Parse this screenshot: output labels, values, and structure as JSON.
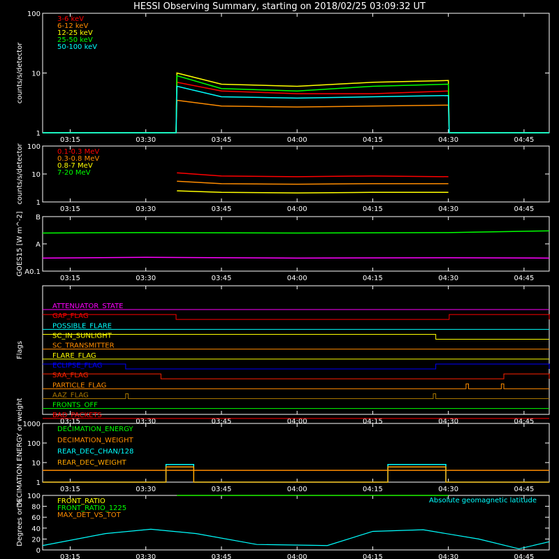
{
  "title": "HESSI Observing Summary, starting on 2018/02/25 03:09:32 UT",
  "x_range": [
    "03:09:32",
    "04:50:00"
  ],
  "x_ticks": [
    "03:15",
    "03:30",
    "03:45",
    "04:00",
    "04:15",
    "04:30",
    "04:45"
  ],
  "colors": {
    "red": "#ff0000",
    "orange": "#ff8c00",
    "yellow": "#ffff00",
    "green": "#00ff00",
    "cyan": "#00ffff",
    "magenta": "#ff00ff",
    "blue": "#0000ff",
    "white": "#ffffff"
  },
  "chart_data": [
    {
      "id": "lc",
      "type": "line",
      "ylabel": "counts/s/detector",
      "yscale": "log",
      "ylim": [
        1,
        100
      ],
      "y_ticks": [
        "1",
        "10",
        "100"
      ],
      "legend_position": "top-left",
      "series": [
        {
          "name": "3-6 keV",
          "color": "#ff0000",
          "x": [
            "03:09:32",
            "03:36:00",
            "03:36:10",
            "03:45:00",
            "04:00:00",
            "04:15:00",
            "04:30:00",
            "04:30:10",
            "04:50:00"
          ],
          "y": [
            1,
            1,
            7,
            5,
            4.5,
            4.5,
            5,
            1,
            1
          ]
        },
        {
          "name": "6-12 keV",
          "color": "#ff8c00",
          "x": [
            "03:09:32",
            "03:36:00",
            "03:36:10",
            "03:45:00",
            "04:00:00",
            "04:15:00",
            "04:30:00",
            "04:30:10",
            "04:50:00"
          ],
          "y": [
            1,
            1,
            3.5,
            2.8,
            2.7,
            2.8,
            2.9,
            1,
            1
          ]
        },
        {
          "name": "12-25 keV",
          "color": "#ffff00",
          "x": [
            "03:09:32",
            "03:36:00",
            "03:36:10",
            "03:45:00",
            "04:00:00",
            "04:15:00",
            "04:30:00",
            "04:30:10",
            "04:50:00"
          ],
          "y": [
            1,
            1,
            10,
            6.5,
            6,
            7,
            7.5,
            1,
            1
          ]
        },
        {
          "name": "25-50 keV",
          "color": "#00ff00",
          "x": [
            "03:09:32",
            "03:36:00",
            "03:36:10",
            "03:45:00",
            "04:00:00",
            "04:15:00",
            "04:30:00",
            "04:30:10",
            "04:50:00"
          ],
          "y": [
            1,
            1,
            9,
            5.5,
            5,
            6,
            6.5,
            1,
            1
          ]
        },
        {
          "name": "50-100 keV",
          "color": "#00ffff",
          "x": [
            "03:09:32",
            "03:36:00",
            "03:36:10",
            "03:45:00",
            "04:00:00",
            "04:15:00",
            "04:30:00",
            "04:30:10",
            "04:50:00"
          ],
          "y": [
            1,
            1,
            6,
            4,
            3.8,
            4,
            4.2,
            1,
            1
          ]
        }
      ]
    },
    {
      "id": "gamma",
      "type": "line",
      "ylabel": "counts/s/detector",
      "yscale": "log",
      "ylim": [
        1,
        100
      ],
      "y_ticks": [
        "1",
        "10",
        "100"
      ],
      "legend_position": "top-left",
      "series": [
        {
          "name": "0.1-0.3 MeV",
          "color": "#ff0000",
          "x": [
            "03:36:10",
            "03:45:00",
            "04:00:00",
            "04:15:00",
            "04:30:00"
          ],
          "y": [
            11,
            8.5,
            8,
            8.5,
            8
          ]
        },
        {
          "name": "0.3-0.8 MeV",
          "color": "#ff8c00",
          "x": [
            "03:36:10",
            "03:45:00",
            "04:00:00",
            "04:15:00",
            "04:30:00"
          ],
          "y": [
            5.5,
            4.5,
            4.3,
            4.5,
            4.5
          ]
        },
        {
          "name": "0.8-7 MeV",
          "color": "#ffff00",
          "x": [
            "03:36:10",
            "03:45:00",
            "04:00:00",
            "04:15:00",
            "04:30:00"
          ],
          "y": [
            2.5,
            2.2,
            2.1,
            2.2,
            2.2
          ]
        },
        {
          "name": "7-20 MeV",
          "color": "#00ff00",
          "x": [],
          "y": []
        }
      ]
    },
    {
      "id": "goes",
      "type": "line",
      "ylabel": "GOES15 [W m^-2]",
      "yscale": "log",
      "ylim": [
        0.1,
        10
      ],
      "y_ticks": [
        "A0.1",
        "A",
        "B"
      ],
      "series": [
        {
          "name": "long",
          "color": "#00ff00",
          "x": [
            "03:09:32",
            "03:30:00",
            "04:00:00",
            "04:30:00",
            "04:50:00"
          ],
          "y": [
            2.5,
            2.6,
            2.5,
            2.6,
            3.0
          ]
        },
        {
          "name": "short",
          "color": "#ff00ff",
          "x": [
            "03:09:32",
            "03:30:00",
            "04:00:00",
            "04:30:00",
            "04:50:00"
          ],
          "y": [
            0.3,
            0.32,
            0.3,
            0.31,
            0.3
          ]
        }
      ]
    },
    {
      "id": "flags",
      "type": "line",
      "ylabel": "Flags",
      "flags": [
        {
          "name": "ATTENUATOR_STATE",
          "color": "#ff00ff",
          "segments": []
        },
        {
          "name": "GAP_FLAG",
          "color": "#ff0000",
          "segments": [
            [
              "03:09:32",
              "03:36:00"
            ],
            [
              "04:30:10",
              "04:50:00"
            ]
          ]
        },
        {
          "name": "POSSIBLE_FLARE",
          "color": "#00ffff",
          "segments": []
        },
        {
          "name": "SC_IN_SUNLIGHT",
          "color": "#ffff00",
          "segments": [
            [
              "03:09:32",
              "04:27:30"
            ]
          ]
        },
        {
          "name": "SC_TRANSMITTER",
          "color": "#ff8c00",
          "segments": []
        },
        {
          "name": "FLARE_FLAG",
          "color": "#ffff00",
          "segments": []
        },
        {
          "name": "ECLIPSE_FLAG",
          "color": "#0000ff",
          "segments": [
            [
              "03:09:32",
              "03:26:00"
            ],
            [
              "04:27:30",
              "04:50:00"
            ]
          ]
        },
        {
          "name": "SAA_FLAG",
          "color": "#ff2200",
          "segments": [
            [
              "03:09:32",
              "03:33:00"
            ],
            [
              "04:41:00",
              "04:50:00"
            ]
          ]
        },
        {
          "name": "PARTICLE_FLAG",
          "color": "#ff8c00",
          "segments": [
            [
              "04:33:30",
              "04:34:00"
            ],
            [
              "04:40:30",
              "04:41:00"
            ]
          ]
        },
        {
          "name": "AAZ_FLAG",
          "color": "#aa7700",
          "segments": [
            [
              "03:26:00",
              "03:26:30"
            ],
            [
              "04:27:00",
              "04:27:30"
            ]
          ]
        },
        {
          "name": "FRONTS_OFF",
          "color": "#00ff00",
          "segments": []
        },
        {
          "name": "BAD_PACKETS",
          "color": "#ff0000",
          "segments": []
        }
      ]
    },
    {
      "id": "decim",
      "type": "line",
      "ylabel": "DECIMATION ENERGY or weight",
      "yscale": "log",
      "ylim": [
        1,
        1000
      ],
      "y_ticks": [
        "1",
        "10",
        "100",
        "1000"
      ],
      "legend_position": "top-left",
      "series": [
        {
          "name": "DECIMATION_ENERGY",
          "color": "#00ff00",
          "x": [],
          "y": []
        },
        {
          "name": "DECIMATION_WEIGHT",
          "color": "#ff8c00",
          "x": [
            "03:09:32",
            "04:50:00"
          ],
          "y": [
            4,
            4
          ]
        },
        {
          "name": "REAR_DEC_CHAN/128",
          "color": "#00ffff",
          "x": [
            "03:09:32",
            "03:34:00",
            "03:34:00",
            "03:39:30",
            "03:39:30",
            "04:18:00",
            "04:18:00",
            "04:29:30",
            "04:29:30",
            "04:50:00"
          ],
          "y": [
            1,
            1,
            8,
            8,
            1,
            1,
            8,
            8,
            1,
            1
          ]
        },
        {
          "name": "REAR_DEC_WEIGHT",
          "color": "#ffa500",
          "x": [
            "03:09:32",
            "03:34:00",
            "03:34:00",
            "03:39:30",
            "03:39:30",
            "04:18:00",
            "04:18:00",
            "04:29:30",
            "04:29:30",
            "04:50:00"
          ],
          "y": [
            1,
            1,
            6,
            6,
            1,
            1,
            6,
            6,
            1,
            1
          ]
        }
      ]
    },
    {
      "id": "ratio",
      "type": "line",
      "ylabel": "Degrees or %",
      "ylim": [
        0,
        100
      ],
      "y_ticks": [
        "0",
        "20",
        "40",
        "60",
        "80",
        "100"
      ],
      "legend_position": "top-left",
      "series": [
        {
          "name": "FRONT_RATIO",
          "color": "#ffff00",
          "x": [
            "03:36:10",
            "04:30:00"
          ],
          "y": [
            100,
            100
          ]
        },
        {
          "name": "FRONT_RATIO_1225",
          "color": "#00ff00",
          "x": [
            "03:36:10",
            "04:30:00"
          ],
          "y": [
            100,
            100
          ]
        },
        {
          "name": "MAX_DET_VS_TOT",
          "color": "#ff8c00",
          "x": [],
          "y": []
        },
        {
          "name": "Absolute geomagnetic latitude",
          "color": "#00ffff",
          "x": [
            "03:09:32",
            "03:22:00",
            "03:31:00",
            "03:40:00",
            "03:52:00",
            "04:06:00",
            "04:15:00",
            "04:25:00",
            "04:36:00",
            "04:44:00",
            "04:50:00"
          ],
          "y": [
            8,
            30,
            38,
            30,
            10,
            8,
            34,
            37,
            20,
            2,
            15
          ]
        }
      ]
    }
  ]
}
